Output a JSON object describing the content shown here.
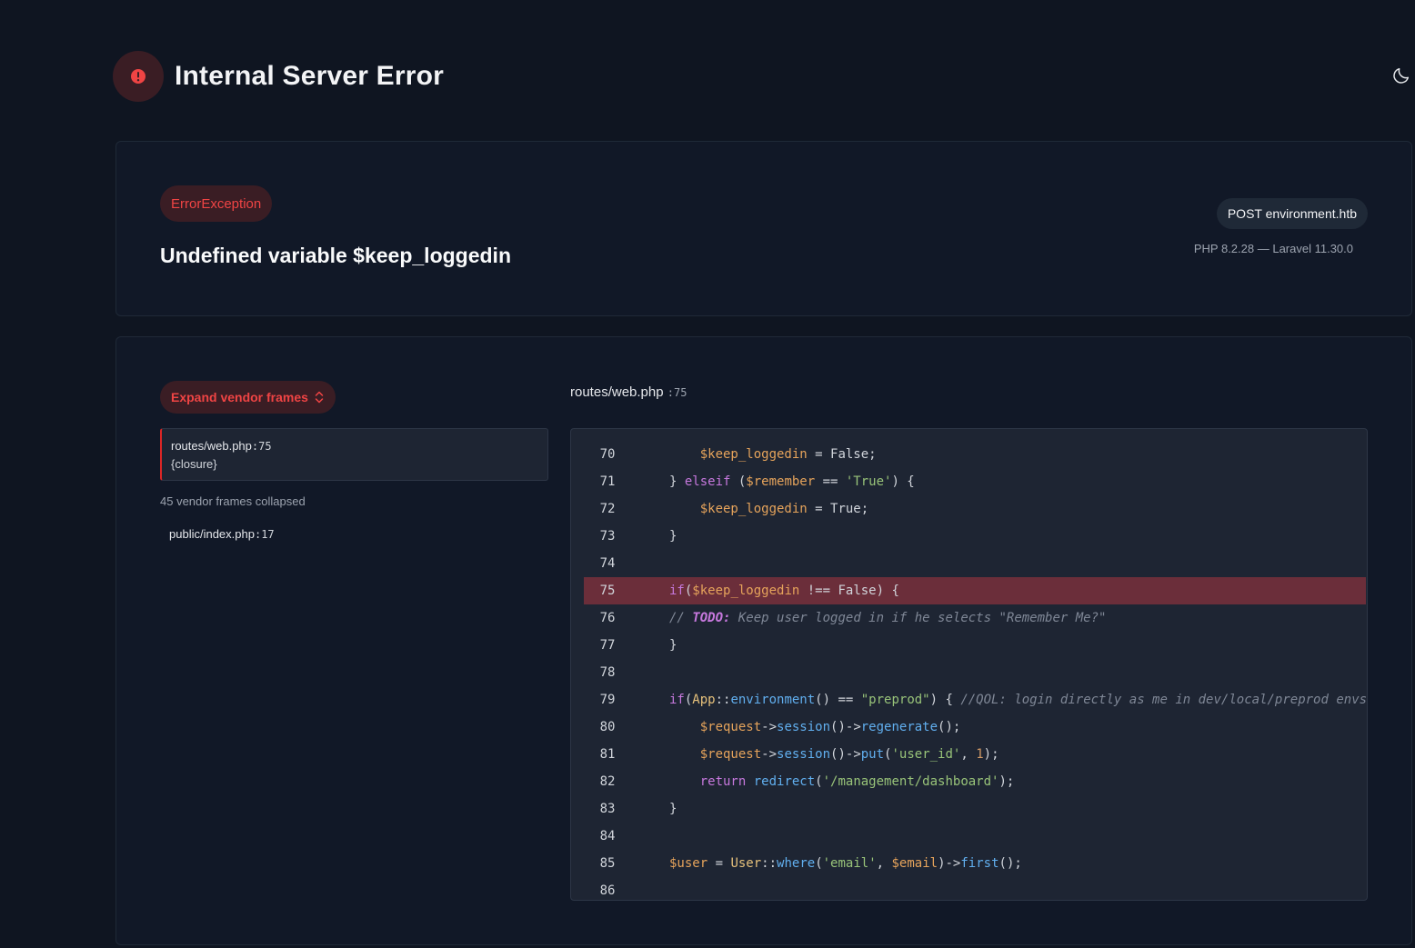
{
  "header": {
    "title": "Internal Server Error"
  },
  "exception": {
    "class": "ErrorException",
    "message": "Undefined variable $keep_loggedin",
    "request": "POST environment.htb",
    "versions": "PHP 8.2.28 — Laravel 11.30.0"
  },
  "frames": {
    "expand_label": "Expand vendor frames",
    "active": {
      "file": "routes/web.php",
      "line": ":75",
      "function": "{closure}"
    },
    "collapsed_label": "45 vendor frames collapsed",
    "other": {
      "file": "public/index.php",
      "line": ":17"
    }
  },
  "code": {
    "file": "routes/web.php",
    "line": ":75",
    "highlight_line": 75,
    "lines": [
      {
        "n": "70",
        "tokens": [
          [
            "plain",
            "    "
          ],
          [
            "var",
            "$keep_loggedin"
          ],
          [
            "plain",
            " = False;"
          ]
        ]
      },
      {
        "n": "71",
        "tokens": [
          [
            "plain",
            "} "
          ],
          [
            "kw",
            "elseif"
          ],
          [
            "plain",
            " ("
          ],
          [
            "var",
            "$remember"
          ],
          [
            "plain",
            " == "
          ],
          [
            "str",
            "'True'"
          ],
          [
            "plain",
            ") {"
          ]
        ]
      },
      {
        "n": "72",
        "tokens": [
          [
            "plain",
            "    "
          ],
          [
            "var",
            "$keep_loggedin"
          ],
          [
            "plain",
            " = True;"
          ]
        ]
      },
      {
        "n": "73",
        "tokens": [
          [
            "plain",
            "}"
          ]
        ]
      },
      {
        "n": "74",
        "tokens": []
      },
      {
        "n": "75",
        "tokens": [
          [
            "kw",
            "if"
          ],
          [
            "plain",
            "("
          ],
          [
            "var",
            "$keep_loggedin"
          ],
          [
            "plain",
            " !== False) {"
          ]
        ]
      },
      {
        "n": "76",
        "tokens": [
          [
            "cmt",
            "// "
          ],
          [
            "todo",
            "TODO:"
          ],
          [
            "cmt",
            " Keep user logged in if he selects \"Remember Me?\""
          ]
        ]
      },
      {
        "n": "77",
        "tokens": [
          [
            "plain",
            "}"
          ]
        ]
      },
      {
        "n": "78",
        "tokens": []
      },
      {
        "n": "79",
        "tokens": [
          [
            "kw",
            "if"
          ],
          [
            "plain",
            "("
          ],
          [
            "cls",
            "App"
          ],
          [
            "plain",
            "::"
          ],
          [
            "fn",
            "environment"
          ],
          [
            "plain",
            "() == "
          ],
          [
            "str",
            "\"preprod\""
          ],
          [
            "plain",
            ") { "
          ],
          [
            "cmt",
            "//QOL: login directly as me in dev/local/preprod envs"
          ]
        ]
      },
      {
        "n": "80",
        "tokens": [
          [
            "plain",
            "    "
          ],
          [
            "var",
            "$request"
          ],
          [
            "plain",
            "->"
          ],
          [
            "fn",
            "session"
          ],
          [
            "plain",
            "()->"
          ],
          [
            "fn",
            "regenerate"
          ],
          [
            "plain",
            "();"
          ]
        ]
      },
      {
        "n": "81",
        "tokens": [
          [
            "plain",
            "    "
          ],
          [
            "var",
            "$request"
          ],
          [
            "plain",
            "->"
          ],
          [
            "fn",
            "session"
          ],
          [
            "plain",
            "()->"
          ],
          [
            "fn",
            "put"
          ],
          [
            "plain",
            "("
          ],
          [
            "str",
            "'user_id'"
          ],
          [
            "plain",
            ", "
          ],
          [
            "num",
            "1"
          ],
          [
            "plain",
            ");"
          ]
        ]
      },
      {
        "n": "82",
        "tokens": [
          [
            "plain",
            "    "
          ],
          [
            "kw",
            "return"
          ],
          [
            "plain",
            " "
          ],
          [
            "fn",
            "redirect"
          ],
          [
            "plain",
            "("
          ],
          [
            "str",
            "'/management/dashboard'"
          ],
          [
            "plain",
            ");"
          ]
        ]
      },
      {
        "n": "83",
        "tokens": [
          [
            "plain",
            "}"
          ]
        ]
      },
      {
        "n": "84",
        "tokens": []
      },
      {
        "n": "85",
        "tokens": [
          [
            "var",
            "$user"
          ],
          [
            "plain",
            " = "
          ],
          [
            "cls",
            "User"
          ],
          [
            "plain",
            "::"
          ],
          [
            "fn",
            "where"
          ],
          [
            "plain",
            "("
          ],
          [
            "str",
            "'email'"
          ],
          [
            "plain",
            ", "
          ],
          [
            "var",
            "$email"
          ],
          [
            "plain",
            ")->"
          ],
          [
            "fn",
            "first"
          ],
          [
            "plain",
            "();"
          ]
        ]
      },
      {
        "n": "86",
        "tokens": []
      }
    ]
  },
  "colors": {
    "accent_red": "#ef4444",
    "highlight_row": "#6b2e3a",
    "background": "#0f1521"
  },
  "icons": {
    "error": "alert-circle-icon",
    "theme": "moon-icon",
    "expand": "chevron-up-down-icon"
  }
}
